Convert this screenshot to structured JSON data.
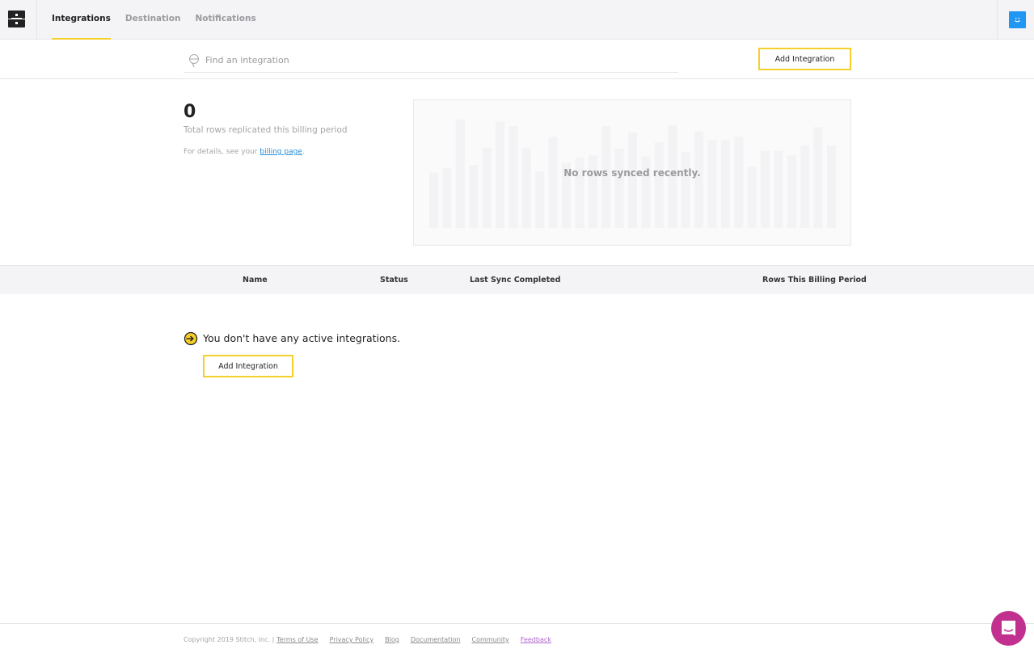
{
  "nav": {
    "tabs": [
      {
        "label": "Integrations",
        "active": true
      },
      {
        "label": "Destination",
        "active": false
      },
      {
        "label": "Notifications",
        "active": false
      }
    ],
    "logo_icon": "stitch-logo-icon",
    "avatar_icon": "smiley-avatar-icon"
  },
  "search": {
    "placeholder": "Find an integration",
    "value": ""
  },
  "toolbar": {
    "add_label": "Add Integration"
  },
  "stats": {
    "total_rows": "0",
    "total_rows_label": "Total rows replicated this billing period",
    "details_prefix": "For details, see your ",
    "billing_link": "billing page",
    "details_suffix": "."
  },
  "chart": {
    "message": "No rows synced recently."
  },
  "chart_data": {
    "type": "bar",
    "title": "",
    "note": "Placeholder skeleton bars shown faded (no real data); values are relative heights 0-1",
    "values": [
      0.51,
      0.55,
      1.0,
      0.58,
      0.74,
      0.98,
      0.94,
      0.74,
      0.52,
      0.84,
      0.6,
      0.65,
      0.67,
      0.94,
      0.73,
      0.88,
      0.66,
      0.79,
      0.95,
      0.7,
      0.89,
      0.81,
      0.81,
      0.84,
      0.56,
      0.71,
      0.71,
      0.67,
      0.76,
      0.93,
      0.76
    ],
    "xlabel": "",
    "ylabel": "",
    "ylim": [
      0,
      1
    ]
  },
  "table": {
    "columns": [
      "Name",
      "Status",
      "Last Sync Completed",
      "Rows This Billing Period"
    ],
    "rows": []
  },
  "empty_state": {
    "message": "You don't have any active integrations.",
    "button_label": "Add Integration"
  },
  "footer": {
    "copyright": "Copyright 2019 Stitch, Inc. |",
    "links": [
      "Terms of Use",
      "Privacy Policy",
      "Blog",
      "Documentation",
      "Community",
      "Feedback"
    ]
  },
  "colors": {
    "accent": "#f5cf2a",
    "link": "#2a8dd8",
    "avatar": "#2196f3",
    "chat": "#c2308f",
    "feedback": "#b066cc"
  }
}
